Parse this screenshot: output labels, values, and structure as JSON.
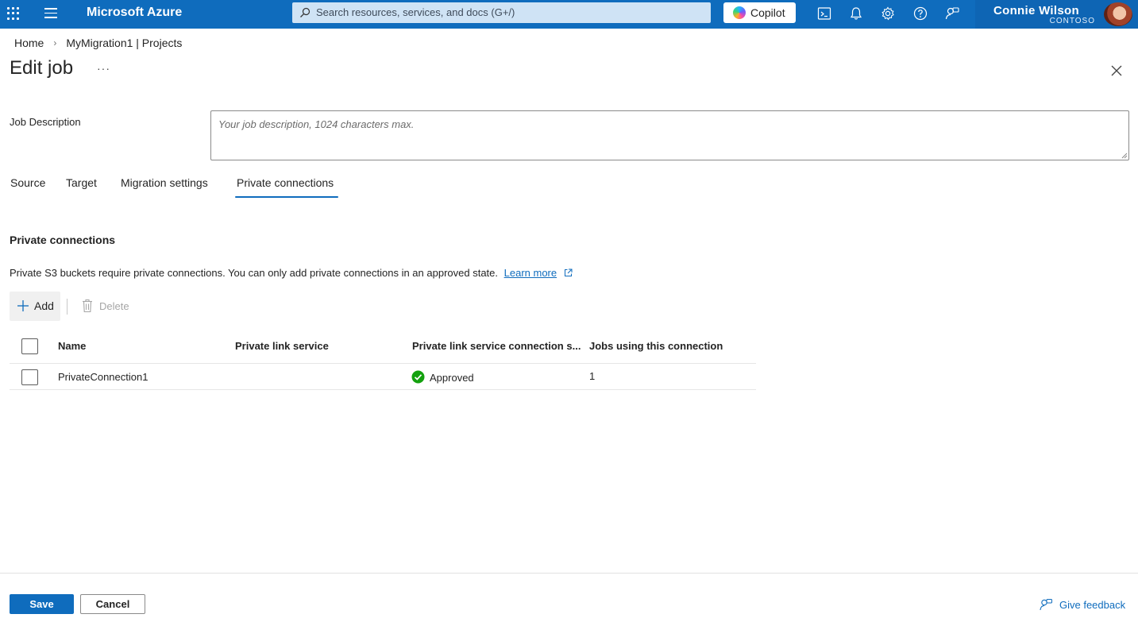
{
  "topbar": {
    "brand": "Microsoft Azure",
    "search_placeholder": "Search resources, services, and docs (G+/)",
    "copilot_label": "Copilot",
    "icons": [
      "waffle-icon",
      "menu-icon",
      "cloud-shell-icon",
      "bell-icon",
      "settings-icon",
      "help-icon",
      "feedback-icon"
    ],
    "user_name": "Connie Wilson",
    "tenant": "CONTOSO",
    "accent": "#0f6cbd"
  },
  "breadcrumb": {
    "home": "Home",
    "project": "MyMigration1 | Projects"
  },
  "header": {
    "title": "Edit job",
    "more": "···"
  },
  "job_description": {
    "label": "Job Description",
    "value": "",
    "placeholder": "Your job description, 1024 characters max."
  },
  "tabs": [
    {
      "label": "Source",
      "active": false
    },
    {
      "label": "Target",
      "active": false
    },
    {
      "label": "Migration settings",
      "active": false
    },
    {
      "label": "Private connections",
      "active": true
    }
  ],
  "section": {
    "title": "Private connections",
    "description": "Private S3 buckets require private connections. You can only add private connections in an approved state.",
    "learn_more": "Learn more"
  },
  "toolbar": {
    "add_label": "Add",
    "delete_label": "Delete"
  },
  "table": {
    "columns": [
      "Name",
      "Private link service",
      "Private link service connection s...",
      "Jobs using this connection"
    ],
    "rows": [
      {
        "name": "PrivateConnection1",
        "private_link_service": "",
        "status": "Approved",
        "jobs": "1"
      }
    ],
    "status_color": "#107c10"
  },
  "footer": {
    "save_label": "Save",
    "cancel_label": "Cancel",
    "feedback_label": "Give feedback"
  }
}
